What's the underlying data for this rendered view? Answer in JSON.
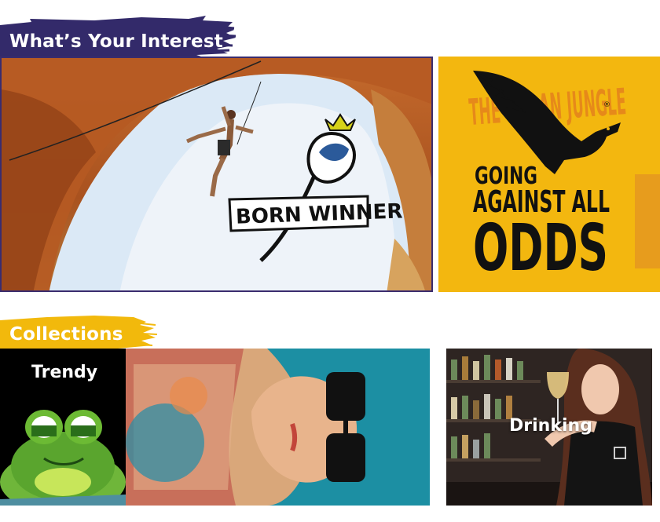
{
  "sections": {
    "interest": {
      "title": "What’s Your Interest",
      "brush_color": "#332a6a"
    },
    "collections": {
      "title": "Collections",
      "brush_color": "#f2b90c"
    }
  },
  "cards": {
    "born_winner": {
      "shirt_text": "BORN WINNER"
    },
    "odds": {
      "line1": "GOING",
      "line2": "AGAINST ALL",
      "line3": "ODDS",
      "watermark": "THE URBAN JUNGLE",
      "registered": "®"
    },
    "trendy": {
      "label": "Trendy"
    },
    "drinking": {
      "label": "Drinking"
    }
  },
  "colors": {
    "accent_purple": "#332a6a",
    "accent_yellow": "#f2b90c",
    "poster_yellow": "#f3b70f"
  }
}
